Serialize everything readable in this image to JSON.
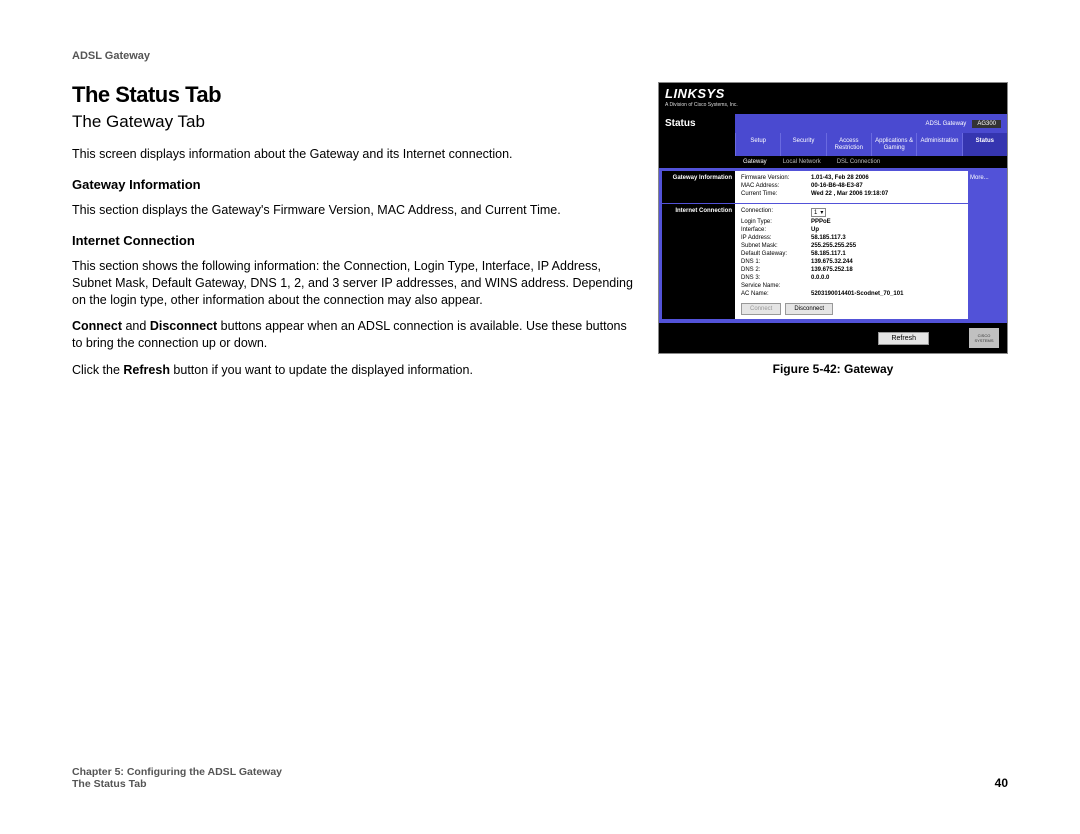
{
  "header": {
    "product": "ADSL Gateway"
  },
  "content": {
    "h1": "The Status Tab",
    "h2": "The Gateway Tab",
    "intro": "This screen displays information about the Gateway and its Internet connection.",
    "section1_title": "Gateway Information",
    "section1_body": "This section displays the Gateway's Firmware Version, MAC Address, and Current Time.",
    "section2_title": "Internet Connection",
    "section2_body": "This section shows the following information: the Connection, Login Type, Interface, IP Address, Subnet Mask, Default Gateway, DNS 1, 2, and 3 server IP addresses, and WINS address. Depending on the login type, other information about the connection may also appear.",
    "section2_body2_prefix": "Connect",
    "section2_body2_mid": " and ",
    "section2_body2_bold2": "Disconnect",
    "section2_body2_suffix": " buttons appear when an ADSL connection is available. Use these buttons to bring the connection up or down.",
    "section2_body3_prefix": "Click the ",
    "section2_body3_bold": "Refresh",
    "section2_body3_suffix": " button if you want to update the displayed information."
  },
  "figure": {
    "caption": "Figure 5-42: Gateway"
  },
  "shot": {
    "logo": "LINKSYS",
    "logo_sub": "A Division of Cisco Systems, Inc.",
    "fw": "Firmware Version: 1.01-43",
    "title": "Status",
    "product_label": "ADSL Gateway",
    "model": "AG300",
    "tabs": [
      "Setup",
      "Security",
      "Access\nRestriction",
      "Applications\n& Gaming",
      "Administration",
      "Status"
    ],
    "subtabs": [
      "Gateway",
      "Local Network",
      "DSL Connection"
    ],
    "panel1": "Gateway Information",
    "panel2": "Internet Connection",
    "help": "More...",
    "gw": {
      "fw_k": "Firmware Version:",
      "fw_v": "1.01-43, Feb 28 2006",
      "mac_k": "MAC Address:",
      "mac_v": "00-16-B6-48-E3-87",
      "time_k": "Current Time:",
      "time_v": "Wed 22 , Mar 2006 19:18:07"
    },
    "ic": {
      "conn_k": "Connection:",
      "conn_v": "1",
      "login_k": "Login Type:",
      "login_v": "PPPoE",
      "iface_k": "Interface:",
      "iface_v": "Up",
      "ip_k": "IP Address:",
      "ip_v": "58.185.117.3",
      "mask_k": "Subnet Mask:",
      "mask_v": "255.255.255.255",
      "dgw_k": "Default Gateway:",
      "dgw_v": "58.185.117.1",
      "dns1_k": "DNS 1:",
      "dns1_v": "139.675.32.244",
      "dns2_k": "DNS 2:",
      "dns2_v": "139.675.252.18",
      "dns3_k": "DNS 3:",
      "dns3_v": "0.0.0.0",
      "svc_k": "Service Name:",
      "ac_k": "AC Name:",
      "ac_v": "5203190014401-Scodnet_70_101"
    },
    "btn_connect": "Connect",
    "btn_disconnect": "Disconnect",
    "btn_refresh": "Refresh",
    "cisco": "CISCO SYSTEMS"
  },
  "footer": {
    "line1": "Chapter 5: Configuring the ADSL Gateway",
    "line2": "The Status Tab",
    "page": "40"
  }
}
